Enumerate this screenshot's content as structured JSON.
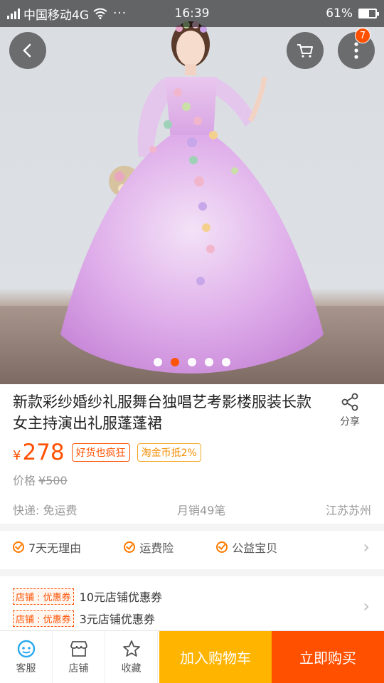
{
  "status_bar": {
    "carrier": "中国移动4G",
    "more": "···",
    "time": "16:39",
    "battery": "61%",
    "battery_level": 0.61
  },
  "gallery": {
    "image_count": 5,
    "active_index": 1
  },
  "header": {
    "cart_badge": "7"
  },
  "product": {
    "title": "新款彩纱婚纱礼服舞台独唱艺考影楼服装长款女主持演出礼服蓬蓬裙",
    "share_label": "分享",
    "currency": "¥",
    "price": "278",
    "tags": [
      "好货也疯狂",
      "淘金币抵2%"
    ],
    "orig_label": "价格",
    "orig_price": "¥500",
    "shipping": "快递: 免运费",
    "monthly_sales": "月销49笔",
    "location": "江苏苏州"
  },
  "services": [
    "7天无理由",
    "运费险",
    "公益宝贝"
  ],
  "coupons": [
    {
      "tag": "店铺 : 优惠券",
      "text": "10元店铺优惠券"
    },
    {
      "tag": "店铺 : 优惠券",
      "text": "3元店铺优惠券"
    }
  ],
  "bottom_bar": {
    "service": "客服",
    "shop": "店铺",
    "favorite": "收藏",
    "add_to_cart": "加入购物车",
    "buy_now": "立即购买"
  },
  "colors": {
    "accent": "#ff5000",
    "cart_button": "#ffb400",
    "dress": "#d8a6e8"
  }
}
